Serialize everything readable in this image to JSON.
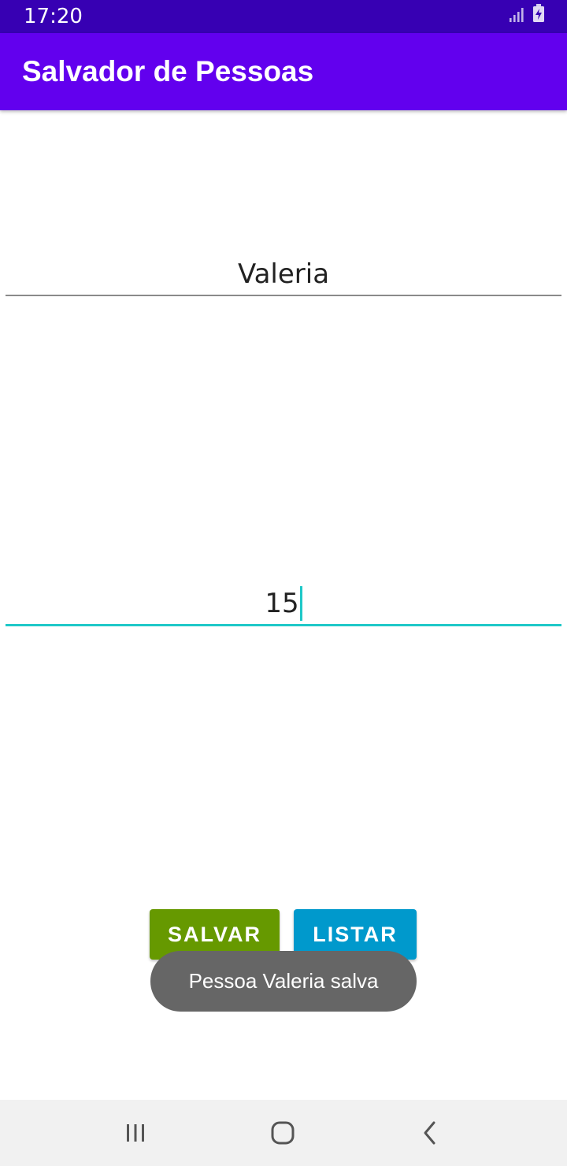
{
  "status_bar": {
    "time": "17:20",
    "icons": [
      "signal-icon",
      "battery-charging-icon"
    ]
  },
  "app_bar": {
    "title": "Salvador de Pessoas"
  },
  "form": {
    "name_value": "Valeria",
    "age_value": "15"
  },
  "buttons": {
    "save_label": "SALVAR",
    "list_label": "LISTAR"
  },
  "toast": {
    "message": "Pessoa Valeria salva"
  },
  "nav_bar": {
    "icons": [
      "recents-icon",
      "home-icon",
      "back-icon"
    ]
  },
  "colors": {
    "status_bar": "#3700b3",
    "app_bar": "#6200ee",
    "accent": "#1ec8c8",
    "save_button": "#669900",
    "list_button": "#0099cc",
    "toast": "#666666",
    "nav_bar": "#f1f1f1"
  }
}
